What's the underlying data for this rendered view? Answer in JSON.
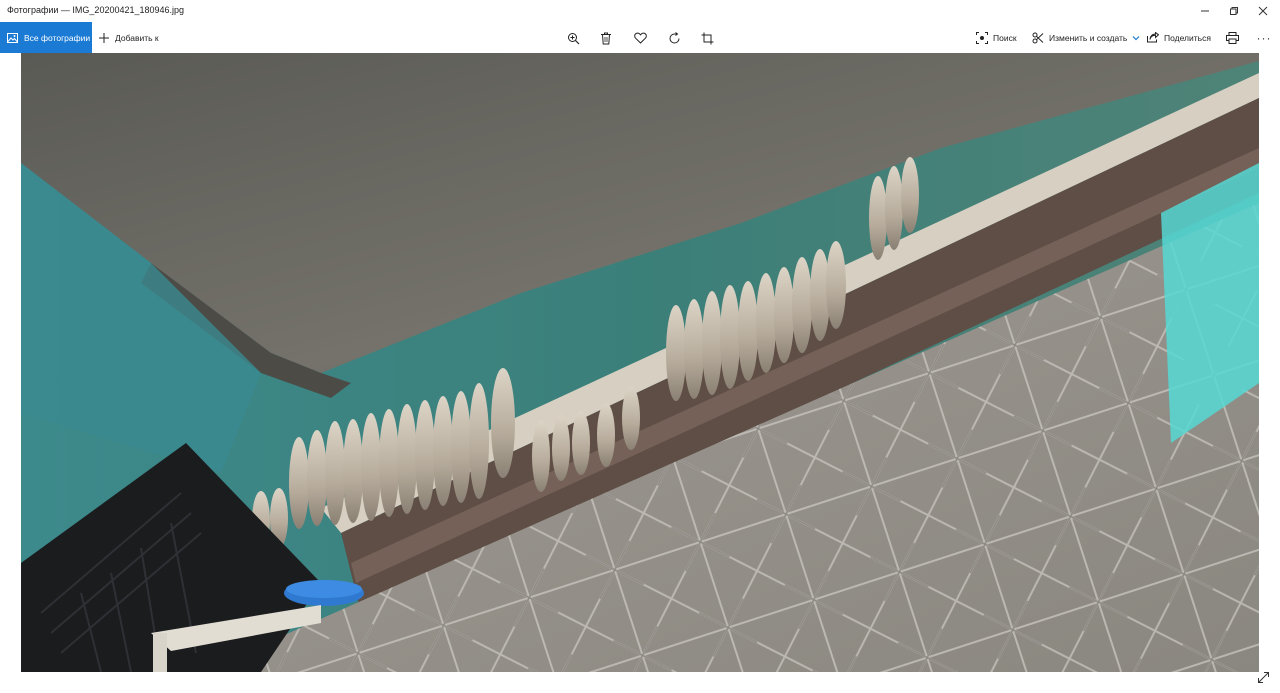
{
  "window": {
    "title": "Фотографии — IMG_20200421_180946.jpg"
  },
  "toolbar": {
    "all_photos_label": "Все фотографии",
    "add_to_label": "Добавить к",
    "search_label": "Поиск",
    "edit_create_label": "Изменить и создать",
    "share_label": "Поделиться",
    "more_label": "···"
  },
  "icons": {
    "all_photos": "photos-icon",
    "add_to": "plus-icon",
    "zoom": "zoom-in-icon",
    "delete": "trash-icon",
    "favorite": "heart-icon",
    "rotate": "rotate-icon",
    "crop": "crop-icon",
    "search": "visual-search-icon",
    "edit_create": "edit-create-icon",
    "share": "share-icon",
    "print": "print-icon",
    "more": "more-icon",
    "fullscreen": "expand-icon"
  },
  "colors": {
    "accent": "#1a7ad4",
    "wall_teal": "#3e8f8b",
    "concrete": "#7b7b73",
    "turquoise_paint": "#56d8d4"
  }
}
